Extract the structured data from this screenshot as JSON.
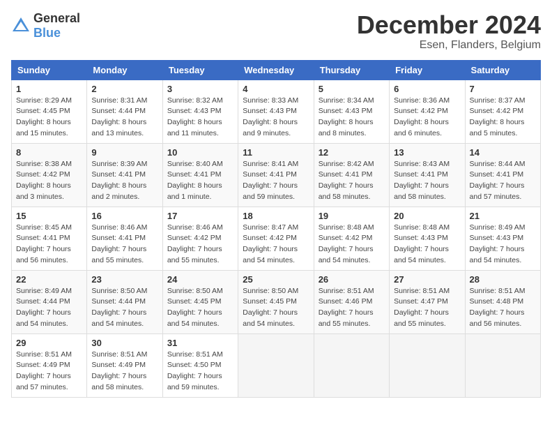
{
  "header": {
    "logo_general": "General",
    "logo_blue": "Blue",
    "month_title": "December 2024",
    "location": "Esen, Flanders, Belgium"
  },
  "weekdays": [
    "Sunday",
    "Monday",
    "Tuesday",
    "Wednesday",
    "Thursday",
    "Friday",
    "Saturday"
  ],
  "weeks": [
    [
      {
        "day": "1",
        "sunrise": "Sunrise: 8:29 AM",
        "sunset": "Sunset: 4:45 PM",
        "daylight": "Daylight: 8 hours and 15 minutes."
      },
      {
        "day": "2",
        "sunrise": "Sunrise: 8:31 AM",
        "sunset": "Sunset: 4:44 PM",
        "daylight": "Daylight: 8 hours and 13 minutes."
      },
      {
        "day": "3",
        "sunrise": "Sunrise: 8:32 AM",
        "sunset": "Sunset: 4:43 PM",
        "daylight": "Daylight: 8 hours and 11 minutes."
      },
      {
        "day": "4",
        "sunrise": "Sunrise: 8:33 AM",
        "sunset": "Sunset: 4:43 PM",
        "daylight": "Daylight: 8 hours and 9 minutes."
      },
      {
        "day": "5",
        "sunrise": "Sunrise: 8:34 AM",
        "sunset": "Sunset: 4:43 PM",
        "daylight": "Daylight: 8 hours and 8 minutes."
      },
      {
        "day": "6",
        "sunrise": "Sunrise: 8:36 AM",
        "sunset": "Sunset: 4:42 PM",
        "daylight": "Daylight: 8 hours and 6 minutes."
      },
      {
        "day": "7",
        "sunrise": "Sunrise: 8:37 AM",
        "sunset": "Sunset: 4:42 PM",
        "daylight": "Daylight: 8 hours and 5 minutes."
      }
    ],
    [
      {
        "day": "8",
        "sunrise": "Sunrise: 8:38 AM",
        "sunset": "Sunset: 4:42 PM",
        "daylight": "Daylight: 8 hours and 3 minutes."
      },
      {
        "day": "9",
        "sunrise": "Sunrise: 8:39 AM",
        "sunset": "Sunset: 4:41 PM",
        "daylight": "Daylight: 8 hours and 2 minutes."
      },
      {
        "day": "10",
        "sunrise": "Sunrise: 8:40 AM",
        "sunset": "Sunset: 4:41 PM",
        "daylight": "Daylight: 8 hours and 1 minute."
      },
      {
        "day": "11",
        "sunrise": "Sunrise: 8:41 AM",
        "sunset": "Sunset: 4:41 PM",
        "daylight": "Daylight: 7 hours and 59 minutes."
      },
      {
        "day": "12",
        "sunrise": "Sunrise: 8:42 AM",
        "sunset": "Sunset: 4:41 PM",
        "daylight": "Daylight: 7 hours and 58 minutes."
      },
      {
        "day": "13",
        "sunrise": "Sunrise: 8:43 AM",
        "sunset": "Sunset: 4:41 PM",
        "daylight": "Daylight: 7 hours and 58 minutes."
      },
      {
        "day": "14",
        "sunrise": "Sunrise: 8:44 AM",
        "sunset": "Sunset: 4:41 PM",
        "daylight": "Daylight: 7 hours and 57 minutes."
      }
    ],
    [
      {
        "day": "15",
        "sunrise": "Sunrise: 8:45 AM",
        "sunset": "Sunset: 4:41 PM",
        "daylight": "Daylight: 7 hours and 56 minutes."
      },
      {
        "day": "16",
        "sunrise": "Sunrise: 8:46 AM",
        "sunset": "Sunset: 4:41 PM",
        "daylight": "Daylight: 7 hours and 55 minutes."
      },
      {
        "day": "17",
        "sunrise": "Sunrise: 8:46 AM",
        "sunset": "Sunset: 4:42 PM",
        "daylight": "Daylight: 7 hours and 55 minutes."
      },
      {
        "day": "18",
        "sunrise": "Sunrise: 8:47 AM",
        "sunset": "Sunset: 4:42 PM",
        "daylight": "Daylight: 7 hours and 54 minutes."
      },
      {
        "day": "19",
        "sunrise": "Sunrise: 8:48 AM",
        "sunset": "Sunset: 4:42 PM",
        "daylight": "Daylight: 7 hours and 54 minutes."
      },
      {
        "day": "20",
        "sunrise": "Sunrise: 8:48 AM",
        "sunset": "Sunset: 4:43 PM",
        "daylight": "Daylight: 7 hours and 54 minutes."
      },
      {
        "day": "21",
        "sunrise": "Sunrise: 8:49 AM",
        "sunset": "Sunset: 4:43 PM",
        "daylight": "Daylight: 7 hours and 54 minutes."
      }
    ],
    [
      {
        "day": "22",
        "sunrise": "Sunrise: 8:49 AM",
        "sunset": "Sunset: 4:44 PM",
        "daylight": "Daylight: 7 hours and 54 minutes."
      },
      {
        "day": "23",
        "sunrise": "Sunrise: 8:50 AM",
        "sunset": "Sunset: 4:44 PM",
        "daylight": "Daylight: 7 hours and 54 minutes."
      },
      {
        "day": "24",
        "sunrise": "Sunrise: 8:50 AM",
        "sunset": "Sunset: 4:45 PM",
        "daylight": "Daylight: 7 hours and 54 minutes."
      },
      {
        "day": "25",
        "sunrise": "Sunrise: 8:50 AM",
        "sunset": "Sunset: 4:45 PM",
        "daylight": "Daylight: 7 hours and 54 minutes."
      },
      {
        "day": "26",
        "sunrise": "Sunrise: 8:51 AM",
        "sunset": "Sunset: 4:46 PM",
        "daylight": "Daylight: 7 hours and 55 minutes."
      },
      {
        "day": "27",
        "sunrise": "Sunrise: 8:51 AM",
        "sunset": "Sunset: 4:47 PM",
        "daylight": "Daylight: 7 hours and 55 minutes."
      },
      {
        "day": "28",
        "sunrise": "Sunrise: 8:51 AM",
        "sunset": "Sunset: 4:48 PM",
        "daylight": "Daylight: 7 hours and 56 minutes."
      }
    ],
    [
      {
        "day": "29",
        "sunrise": "Sunrise: 8:51 AM",
        "sunset": "Sunset: 4:49 PM",
        "daylight": "Daylight: 7 hours and 57 minutes."
      },
      {
        "day": "30",
        "sunrise": "Sunrise: 8:51 AM",
        "sunset": "Sunset: 4:49 PM",
        "daylight": "Daylight: 7 hours and 58 minutes."
      },
      {
        "day": "31",
        "sunrise": "Sunrise: 8:51 AM",
        "sunset": "Sunset: 4:50 PM",
        "daylight": "Daylight: 7 hours and 59 minutes."
      },
      null,
      null,
      null,
      null
    ]
  ]
}
